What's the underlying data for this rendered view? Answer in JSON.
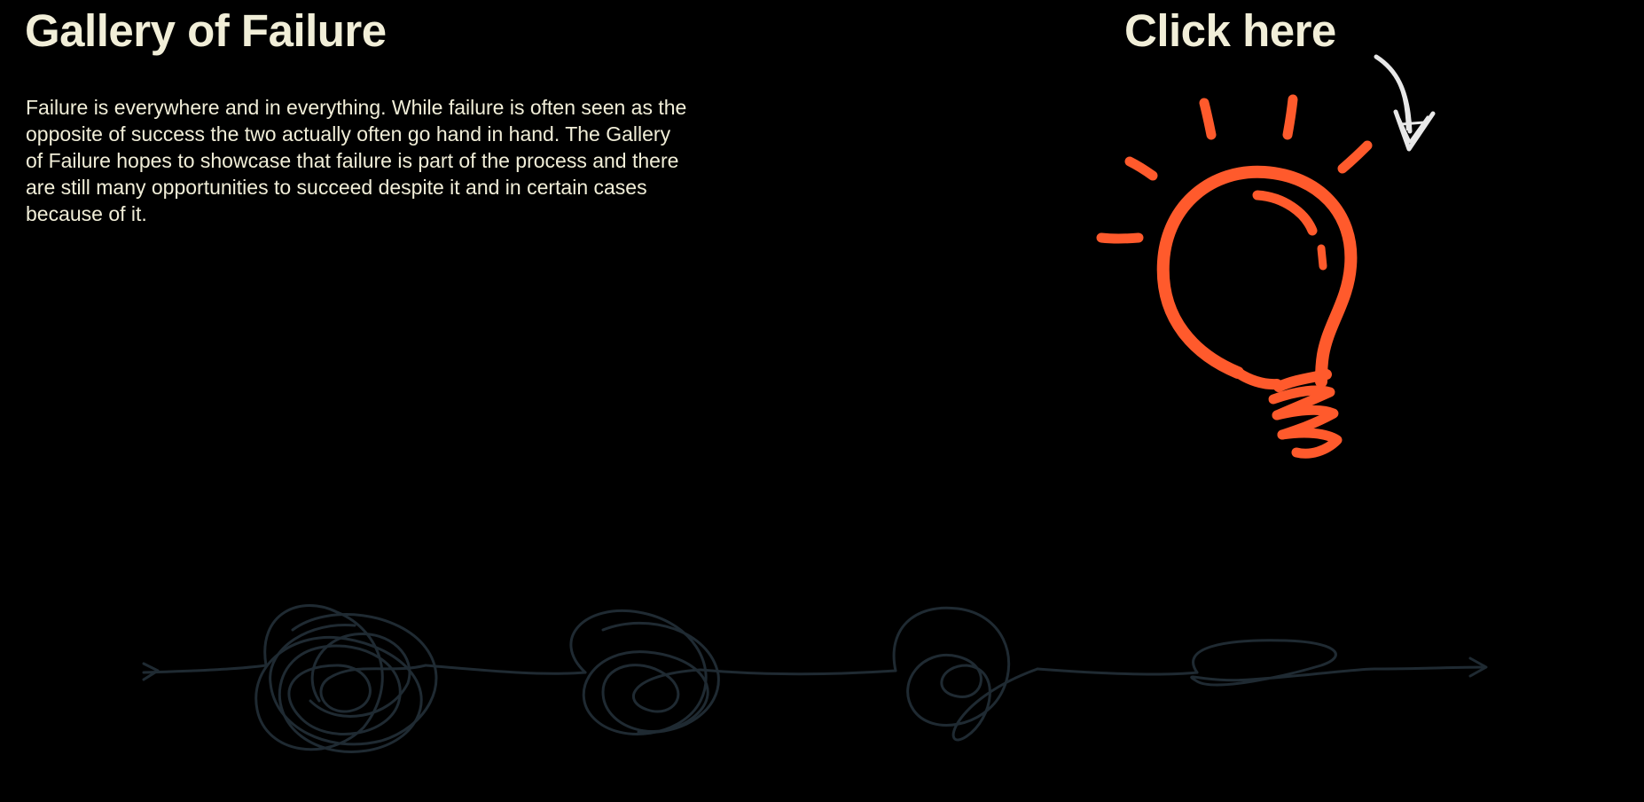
{
  "page": {
    "title": "Gallery of Failure",
    "intro": "Failure is everywhere and in everything. While failure is often seen as the opposite of success the two actually often go hand in hand. The Gallery of Failure hopes to showcase that failure is part of the process and there are still many opportunities to succeed despite it and in certain cases because of it.",
    "cta_label": "Click here"
  },
  "icons": {
    "cta_arrow": "curved-arrow-icon",
    "bulb": "lightbulb-icon",
    "timeline": "tangled-line-arrow-icon"
  },
  "colors": {
    "background": "#000000",
    "text": "#f1eed8",
    "accent": "#ff5a2c",
    "arrow": "#e8e8e8",
    "tangle": "#1f2a32"
  }
}
